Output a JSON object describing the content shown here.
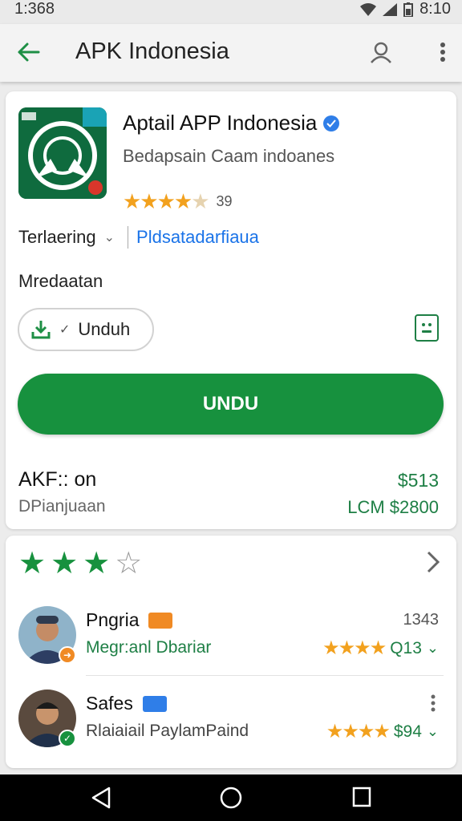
{
  "status_bar": {
    "time": "1:368",
    "clock_right": "8:10"
  },
  "app_bar": {
    "title": "APK Indonesia"
  },
  "app": {
    "name": "Aptail APP Indonesia",
    "developer": "Bedapsain Caam indoanes",
    "rating_count": "39",
    "category": "Terlaering",
    "category_link": "Pldsatadarfiaua",
    "section_label": "Mredaatan",
    "download_pill_label": "Unduh",
    "install_button_label": "UNDU",
    "info_title": "AKF:: on",
    "info_subtitle": "DPianjuaan",
    "price": "$513",
    "price_sub": "LCM $2800"
  },
  "reviews_section": {
    "overall_stars": 3,
    "max_stars": 4
  },
  "reviews": [
    {
      "name": "Pngria",
      "meta": "1343",
      "text": "Megr:anl Dbariar",
      "score": "Q13",
      "tag_color": "#f08a24"
    },
    {
      "name": "Safes",
      "meta": "",
      "text": "Rlaiaiail PaylamPaind",
      "score": "$94",
      "tag_color": "#2f7ee8"
    }
  ],
  "colors": {
    "accent_green": "#17913e",
    "star_orange": "#f2a11e",
    "link_blue": "#1a73e8"
  },
  "icons": [
    "back-arrow-icon",
    "account-icon",
    "more-vert-icon",
    "verified-icon",
    "download-icon",
    "check-icon",
    "share-icon",
    "chevron-right-icon",
    "nav-back-icon",
    "nav-home-icon",
    "nav-recents-icon"
  ]
}
